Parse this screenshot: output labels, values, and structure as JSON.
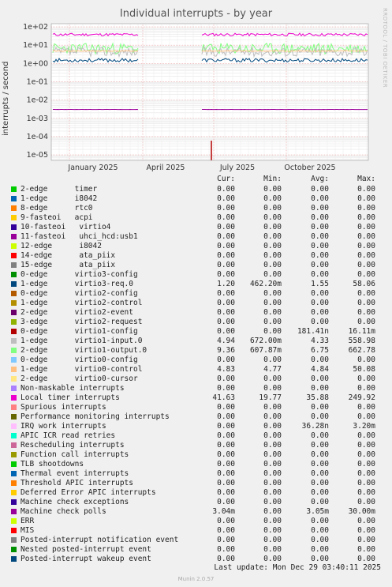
{
  "chart_data": {
    "type": "line",
    "title": "Individual interrupts - by year",
    "ylabel": "interrupts / second",
    "yscale": "log",
    "ylim": [
      5e-06,
      150
    ],
    "yticks": [
      "1e+02",
      "1e+01",
      "1e+00",
      "1e-01",
      "1e-02",
      "1e-03",
      "1e-04",
      "1e-05"
    ],
    "xticks": [
      "January 2025",
      "April 2025",
      "July 2025",
      "October 2025"
    ],
    "grid": true,
    "side_label": "RRDTOOL / TOBI OETIKER",
    "columns": [
      "Cur:",
      "Min:",
      "Avg:",
      "Max:"
    ],
    "series": [
      {
        "name": "2-edge      timer",
        "color": "#00cc00",
        "cur": "0.00",
        "min": "0.00",
        "avg": "0.00",
        "max": "0.00"
      },
      {
        "name": "1-edge      i8042",
        "color": "#0066b3",
        "cur": "0.00",
        "min": "0.00",
        "avg": "0.00",
        "max": "0.00"
      },
      {
        "name": "8-edge      rtc0",
        "color": "#ff8000",
        "cur": "0.00",
        "min": "0.00",
        "avg": "0.00",
        "max": "0.00"
      },
      {
        "name": "9-fasteoi   acpi",
        "color": "#ffcc00",
        "cur": "0.00",
        "min": "0.00",
        "avg": "0.00",
        "max": "0.00"
      },
      {
        "name": "10-fasteoi   virtio4",
        "color": "#330099",
        "cur": "0.00",
        "min": "0.00",
        "avg": "0.00",
        "max": "0.00"
      },
      {
        "name": "11-fasteoi   uhci_hcd:usb1",
        "color": "#990099",
        "cur": "0.00",
        "min": "0.00",
        "avg": "0.00",
        "max": "0.00"
      },
      {
        "name": "12-edge      i8042",
        "color": "#ccff00",
        "cur": "0.00",
        "min": "0.00",
        "avg": "0.00",
        "max": "0.00"
      },
      {
        "name": "14-edge      ata_piix",
        "color": "#ff0000",
        "cur": "0.00",
        "min": "0.00",
        "avg": "0.00",
        "max": "0.00"
      },
      {
        "name": "15-edge      ata_piix",
        "color": "#808080",
        "cur": "0.00",
        "min": "0.00",
        "avg": "0.00",
        "max": "0.00"
      },
      {
        "name": "0-edge      virtio3-config",
        "color": "#008f00",
        "cur": "0.00",
        "min": "0.00",
        "avg": "0.00",
        "max": "0.00"
      },
      {
        "name": "1-edge      virtio3-req.0",
        "color": "#00487d",
        "cur": "1.20",
        "min": "462.20m",
        "avg": "1.55",
        "max": "58.06"
      },
      {
        "name": "0-edge      virtio2-config",
        "color": "#b35a00",
        "cur": "0.00",
        "min": "0.00",
        "avg": "0.00",
        "max": "0.00"
      },
      {
        "name": "1-edge      virtio2-control",
        "color": "#b38f00",
        "cur": "0.00",
        "min": "0.00",
        "avg": "0.00",
        "max": "0.00"
      },
      {
        "name": "2-edge      virtio2-event",
        "color": "#6b006b",
        "cur": "0.00",
        "min": "0.00",
        "avg": "0.00",
        "max": "0.00"
      },
      {
        "name": "3-edge      virtio2-request",
        "color": "#8fb300",
        "cur": "0.00",
        "min": "0.00",
        "avg": "0.00",
        "max": "0.00"
      },
      {
        "name": "0-edge      virtio1-config",
        "color": "#b30000",
        "cur": "0.00",
        "min": "0.00",
        "avg": "181.41n",
        "max": "16.11m"
      },
      {
        "name": "1-edge      virtio1-input.0",
        "color": "#bebebe",
        "cur": "4.94",
        "min": "672.00m",
        "avg": "4.33",
        "max": "558.98"
      },
      {
        "name": "2-edge      virtio1-output.0",
        "color": "#80ff80",
        "cur": "9.36",
        "min": "607.87m",
        "avg": "6.75",
        "max": "662.78"
      },
      {
        "name": "0-edge      virtio0-config",
        "color": "#80c9ff",
        "cur": "0.00",
        "min": "0.00",
        "avg": "0.00",
        "max": "0.00"
      },
      {
        "name": "1-edge      virtio0-control",
        "color": "#ffc080",
        "cur": "4.83",
        "min": "4.77",
        "avg": "4.84",
        "max": "50.08"
      },
      {
        "name": "2-edge      virtio0-cursor",
        "color": "#ffe680",
        "cur": "0.00",
        "min": "0.00",
        "avg": "0.00",
        "max": "0.00"
      },
      {
        "name": "Non-maskable interrupts",
        "color": "#aa80ff",
        "cur": "0.00",
        "min": "0.00",
        "avg": "0.00",
        "max": "0.00"
      },
      {
        "name": "Local timer interrupts",
        "color": "#ee00cc",
        "cur": "41.63",
        "min": "19.77",
        "avg": "35.88",
        "max": "249.92"
      },
      {
        "name": "Spurious interrupts",
        "color": "#ff8080",
        "cur": "0.00",
        "min": "0.00",
        "avg": "0.00",
        "max": "0.00"
      },
      {
        "name": "Performance monitoring interrupts",
        "color": "#666600",
        "cur": "0.00",
        "min": "0.00",
        "avg": "0.00",
        "max": "0.00"
      },
      {
        "name": "IRQ work interrupts",
        "color": "#ffbfff",
        "cur": "0.00",
        "min": "0.00",
        "avg": "36.28n",
        "max": "3.20m"
      },
      {
        "name": "APIC ICR read retries",
        "color": "#00ffcc",
        "cur": "0.00",
        "min": "0.00",
        "avg": "0.00",
        "max": "0.00"
      },
      {
        "name": "Rescheduling interrupts",
        "color": "#cc6699",
        "cur": "0.00",
        "min": "0.00",
        "avg": "0.00",
        "max": "0.00"
      },
      {
        "name": "Function call interrupts",
        "color": "#999900",
        "cur": "0.00",
        "min": "0.00",
        "avg": "0.00",
        "max": "0.00"
      },
      {
        "name": "TLB shootdowns",
        "color": "#00cc00",
        "cur": "0.00",
        "min": "0.00",
        "avg": "0.00",
        "max": "0.00"
      },
      {
        "name": "Thermal event interrupts",
        "color": "#0066b3",
        "cur": "0.00",
        "min": "0.00",
        "avg": "0.00",
        "max": "0.00"
      },
      {
        "name": "Threshold APIC interrupts",
        "color": "#ff8000",
        "cur": "0.00",
        "min": "0.00",
        "avg": "0.00",
        "max": "0.00"
      },
      {
        "name": "Deferred Error APIC interrupts",
        "color": "#ffcc00",
        "cur": "0.00",
        "min": "0.00",
        "avg": "0.00",
        "max": "0.00"
      },
      {
        "name": "Machine check exceptions",
        "color": "#330099",
        "cur": "0.00",
        "min": "0.00",
        "avg": "0.00",
        "max": "0.00"
      },
      {
        "name": "Machine check polls",
        "color": "#990099",
        "cur": "3.04m",
        "min": "0.00",
        "avg": "3.05m",
        "max": "30.00m"
      },
      {
        "name": "ERR",
        "color": "#ccff00",
        "cur": "0.00",
        "min": "0.00",
        "avg": "0.00",
        "max": "0.00"
      },
      {
        "name": "MIS",
        "color": "#ff0000",
        "cur": "0.00",
        "min": "0.00",
        "avg": "0.00",
        "max": "0.00"
      },
      {
        "name": "Posted-interrupt notification event",
        "color": "#808080",
        "cur": "0.00",
        "min": "0.00",
        "avg": "0.00",
        "max": "0.00"
      },
      {
        "name": "Nested posted-interrupt event",
        "color": "#008f00",
        "cur": "0.00",
        "min": "0.00",
        "avg": "0.00",
        "max": "0.00"
      },
      {
        "name": "Posted-interrupt wakeup event",
        "color": "#00487d",
        "cur": "0.00",
        "min": "0.00",
        "avg": "0.00",
        "max": "0.00"
      }
    ]
  },
  "footer": {
    "last_update": "Last update: Mon Dec 29 03:40:11 2025",
    "generator": "Munin 2.0.57"
  }
}
